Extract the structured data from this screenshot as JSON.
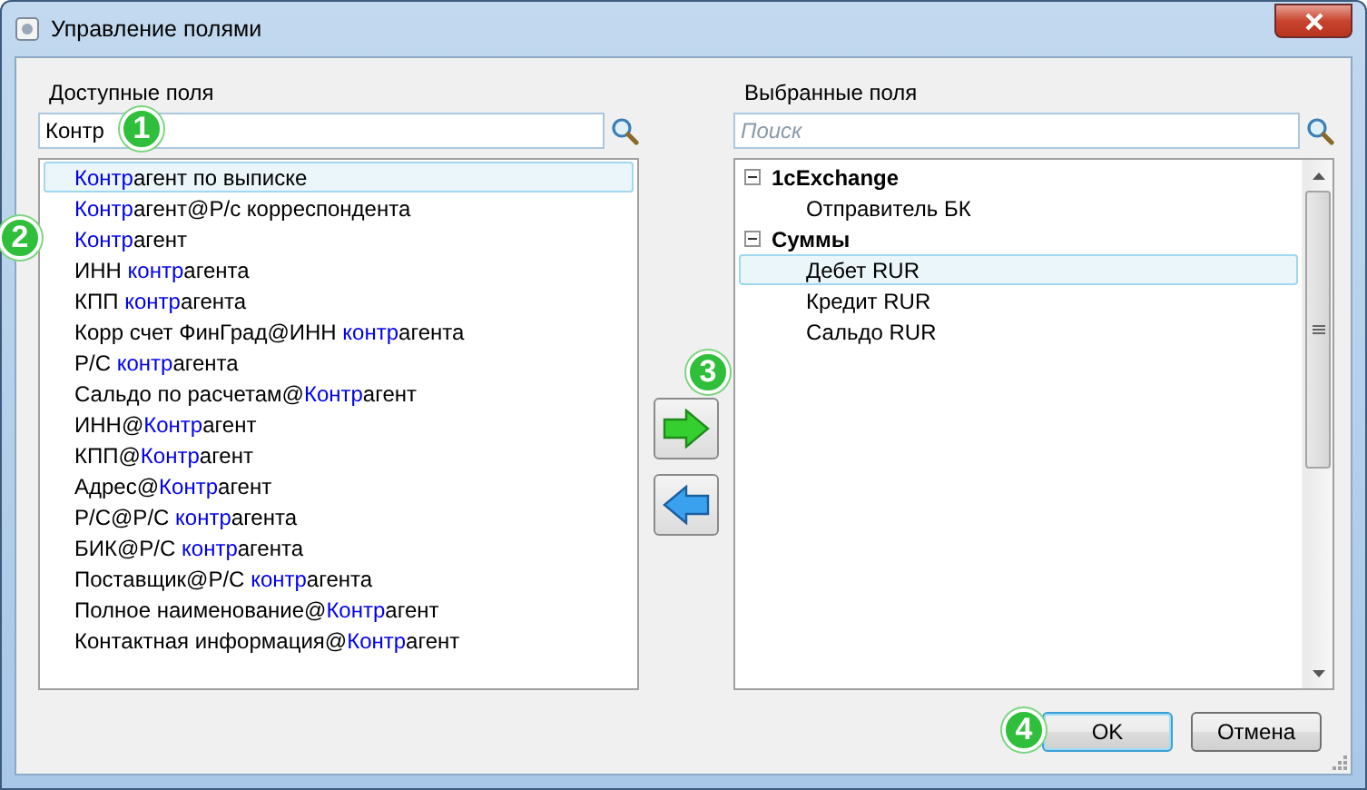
{
  "window": {
    "title": "Управление полями"
  },
  "available": {
    "label": "Доступные поля",
    "search": {
      "value": "Контр",
      "badge": "1"
    },
    "items": [
      {
        "parts": [
          {
            "text": "Контр",
            "match": true
          },
          {
            "text": "агент по выписке",
            "match": false
          }
        ],
        "selected": true
      },
      {
        "parts": [
          {
            "text": "Контр",
            "match": true
          },
          {
            "text": "агент@Р/с корреспондента",
            "match": false
          }
        ],
        "selected": false
      },
      {
        "parts": [
          {
            "text": "Контр",
            "match": true
          },
          {
            "text": "агент",
            "match": false
          }
        ],
        "selected": false,
        "badge": "2"
      },
      {
        "parts": [
          {
            "text": "ИНН ",
            "match": false
          },
          {
            "text": "контр",
            "match": true
          },
          {
            "text": "агента",
            "match": false
          }
        ],
        "selected": false
      },
      {
        "parts": [
          {
            "text": "КПП ",
            "match": false
          },
          {
            "text": "контр",
            "match": true
          },
          {
            "text": "агента",
            "match": false
          }
        ],
        "selected": false
      },
      {
        "parts": [
          {
            "text": "Корр счет ФинГрад@ИНН ",
            "match": false
          },
          {
            "text": "контр",
            "match": true
          },
          {
            "text": "агента",
            "match": false
          }
        ],
        "selected": false
      },
      {
        "parts": [
          {
            "text": "Р/С ",
            "match": false
          },
          {
            "text": "контр",
            "match": true
          },
          {
            "text": "агента",
            "match": false
          }
        ],
        "selected": false
      },
      {
        "parts": [
          {
            "text": "Сальдо по расчетам@",
            "match": false
          },
          {
            "text": "Контр",
            "match": true
          },
          {
            "text": "агент",
            "match": false
          }
        ],
        "selected": false
      },
      {
        "parts": [
          {
            "text": "ИНН@",
            "match": false
          },
          {
            "text": "Контр",
            "match": true
          },
          {
            "text": "агент",
            "match": false
          }
        ],
        "selected": false
      },
      {
        "parts": [
          {
            "text": "КПП@",
            "match": false
          },
          {
            "text": "Контр",
            "match": true
          },
          {
            "text": "агент",
            "match": false
          }
        ],
        "selected": false
      },
      {
        "parts": [
          {
            "text": "Адрес@",
            "match": false
          },
          {
            "text": "Контр",
            "match": true
          },
          {
            "text": "агент",
            "match": false
          }
        ],
        "selected": false
      },
      {
        "parts": [
          {
            "text": "Р/С@Р/С ",
            "match": false
          },
          {
            "text": "контр",
            "match": true
          },
          {
            "text": "агента",
            "match": false
          }
        ],
        "selected": false
      },
      {
        "parts": [
          {
            "text": "БИК@Р/С ",
            "match": false
          },
          {
            "text": "контр",
            "match": true
          },
          {
            "text": "агента",
            "match": false
          }
        ],
        "selected": false
      },
      {
        "parts": [
          {
            "text": "Поставщик@Р/С ",
            "match": false
          },
          {
            "text": "контр",
            "match": true
          },
          {
            "text": "агента",
            "match": false
          }
        ],
        "selected": false
      },
      {
        "parts": [
          {
            "text": "Полное наименование@",
            "match": false
          },
          {
            "text": "Контр",
            "match": true
          },
          {
            "text": "агент",
            "match": false
          }
        ],
        "selected": false
      },
      {
        "parts": [
          {
            "text": "Контактная информация@",
            "match": false
          },
          {
            "text": "Контр",
            "match": true
          },
          {
            "text": "агент",
            "match": false
          }
        ],
        "selected": false
      }
    ]
  },
  "transfer": {
    "add_badge": "3"
  },
  "chosen": {
    "label": "Выбранные поля",
    "search": {
      "placeholder": "Поиск"
    },
    "groups": [
      {
        "label": "1cExchange",
        "expanded": true,
        "children": [
          {
            "label": "Отправитель БК",
            "selected": false
          }
        ]
      },
      {
        "label": "Суммы",
        "expanded": true,
        "children": [
          {
            "label": "Дебет RUR",
            "selected": true
          },
          {
            "label": "Кредит RUR",
            "selected": false
          },
          {
            "label": "Сальдо RUR",
            "selected": false
          }
        ]
      }
    ]
  },
  "buttons": [
    {
      "label": "OK",
      "kind": "default",
      "badge": "4"
    },
    {
      "label": "Отмена",
      "kind": "normal"
    }
  ]
}
